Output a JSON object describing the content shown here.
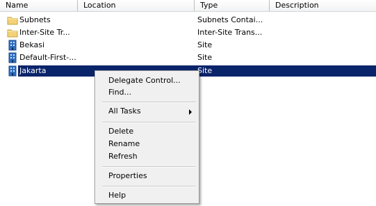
{
  "columns": {
    "name": "Name",
    "location": "Location",
    "type": "Type",
    "description": "Description"
  },
  "rows": [
    {
      "name": "Subnets",
      "type": "Subnets Contai...",
      "icon": "folder-icon"
    },
    {
      "name": "Inter-Site Tr...",
      "type": "Inter-Site Trans...",
      "icon": "folder-icon"
    },
    {
      "name": "Bekasi",
      "type": "Site",
      "icon": "site-icon"
    },
    {
      "name": "Default-First-...",
      "type": "Site",
      "icon": "site-icon"
    },
    {
      "name": "Jakarta",
      "type": "Site",
      "icon": "site-icon",
      "selected": true
    }
  ],
  "context_menu": {
    "delegate_control": "Delegate Control...",
    "find": "Find...",
    "all_tasks": "All Tasks",
    "delete": "Delete",
    "rename": "Rename",
    "refresh": "Refresh",
    "properties": "Properties",
    "help": "Help"
  },
  "colors": {
    "selection": "#0a246a",
    "folder": "#f2d27a",
    "site": "#2f6fc2"
  }
}
